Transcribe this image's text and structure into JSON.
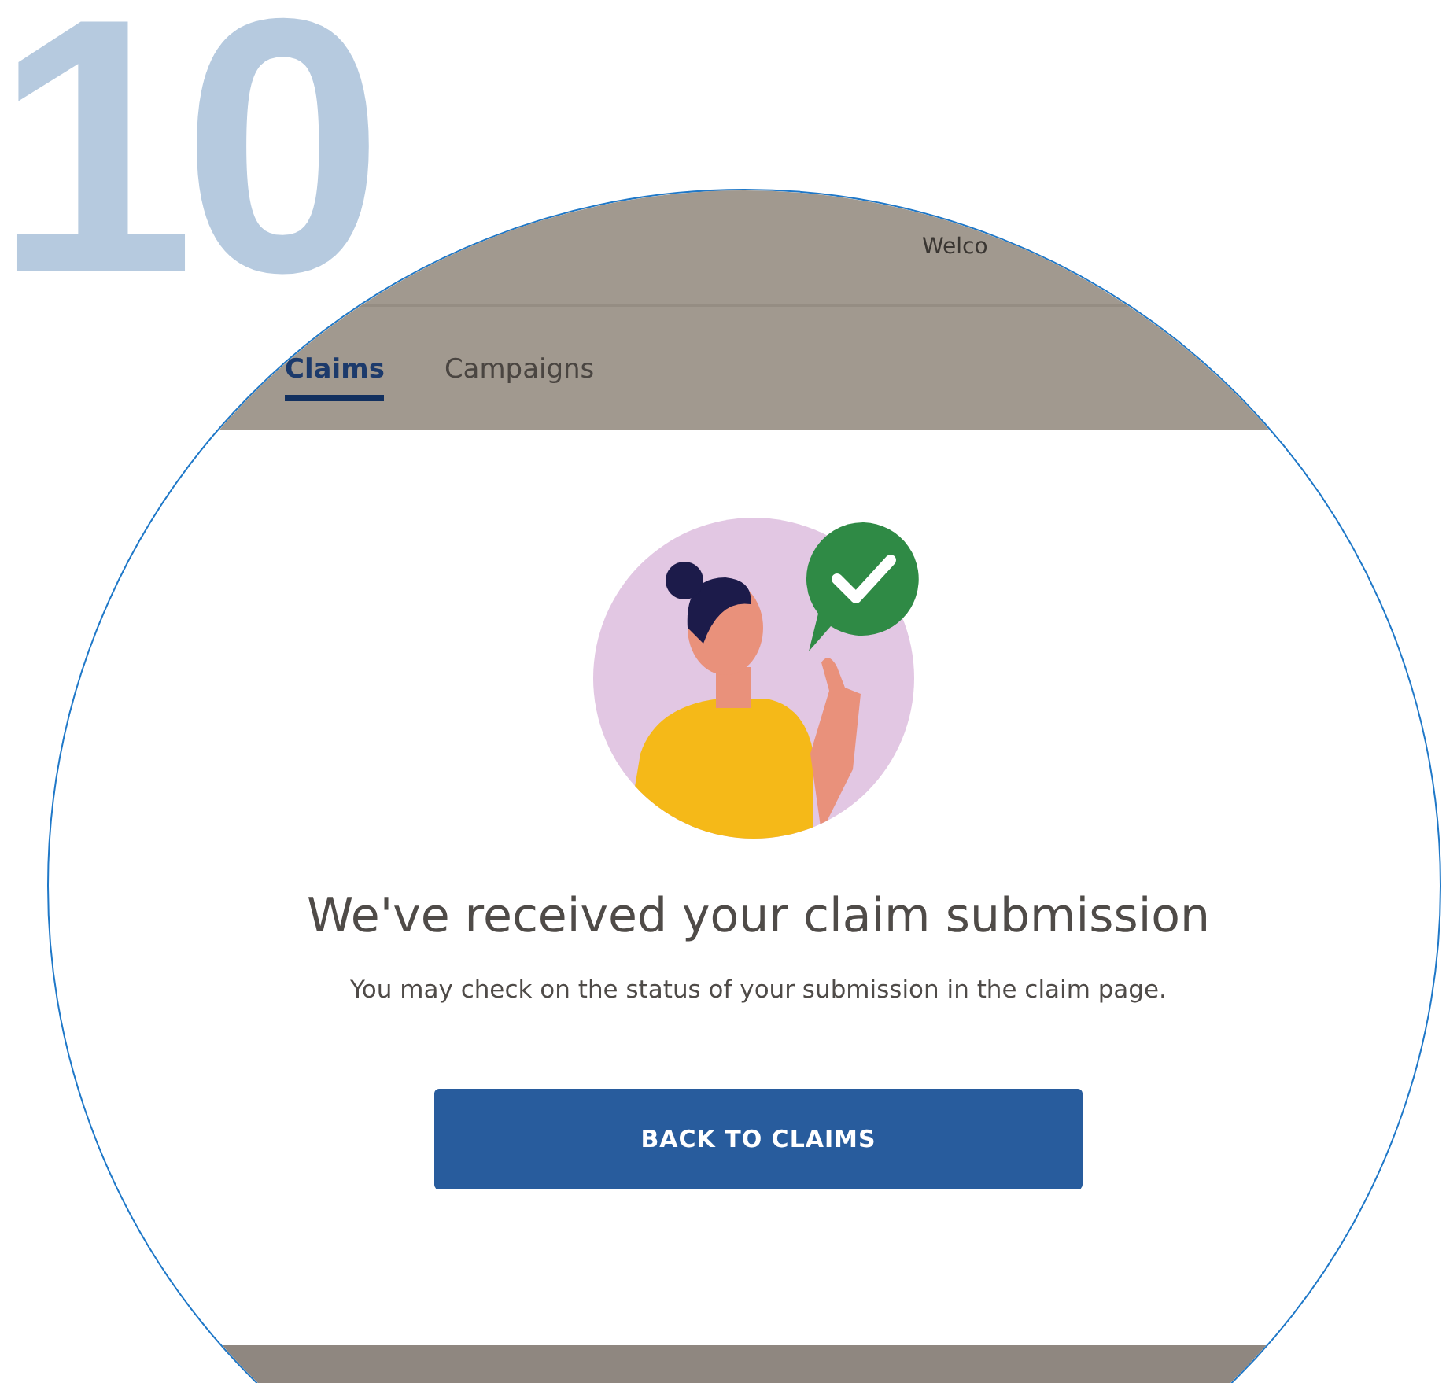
{
  "step_number": "10",
  "header": {
    "welcome": "Welco"
  },
  "tabs": [
    {
      "label": "Claims",
      "selected": true
    },
    {
      "label": "Campaigns",
      "selected": false
    }
  ],
  "confirmation": {
    "title": "We've received your claim submission",
    "message": "You may check on the status of your submission in the claim page.",
    "button": "BACK TO CLAIMS"
  }
}
